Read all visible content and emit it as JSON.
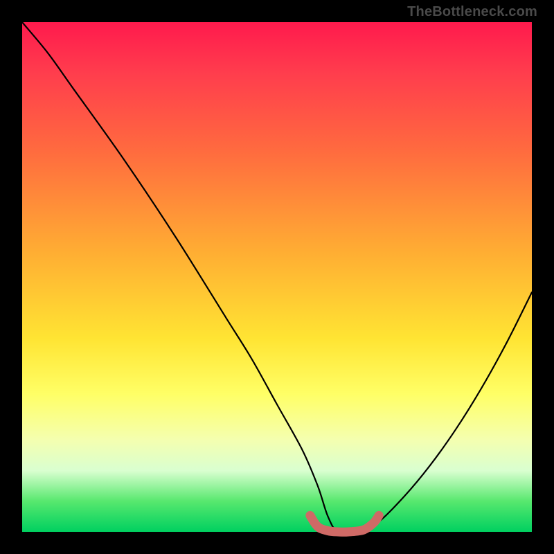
{
  "attribution": "TheBottleneck.com",
  "colors": {
    "marker": "#cf6a66",
    "curve": "#000000",
    "gradient_top": "#ff1a4d",
    "gradient_bottom": "#00d060"
  },
  "chart_data": {
    "type": "line",
    "title": "",
    "xlabel": "",
    "ylabel": "",
    "xlim": [
      0,
      100
    ],
    "ylim": [
      0,
      100
    ],
    "series": [
      {
        "name": "bottleneck-curve",
        "x": [
          0,
          5,
          10,
          20,
          30,
          40,
          45,
          50,
          55,
          58,
          60,
          62,
          66,
          70,
          75,
          80,
          85,
          90,
          95,
          100
        ],
        "values": [
          100,
          94,
          87,
          73,
          58,
          42,
          34,
          25,
          16,
          9,
          3,
          0,
          0,
          2,
          7,
          13,
          20,
          28,
          37,
          47
        ]
      },
      {
        "name": "recommended-range-marker",
        "x": [
          56.5,
          58,
          60,
          62,
          64,
          67,
          69,
          70
        ],
        "values": [
          3.2,
          1.0,
          0.2,
          0.0,
          0.0,
          0.4,
          1.8,
          3.2
        ]
      }
    ],
    "annotations": []
  }
}
